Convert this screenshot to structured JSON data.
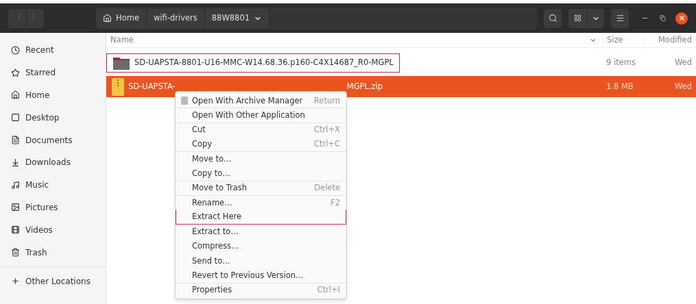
{
  "nav": {
    "back": "〈",
    "forward": "〉"
  },
  "breadcrumbs": [
    {
      "label": "Home",
      "kind": "home"
    },
    {
      "label": "wifi-drivers",
      "kind": "plain"
    },
    {
      "label": "88W8801",
      "kind": "current"
    }
  ],
  "sidebar": {
    "items": [
      {
        "label": "Recent"
      },
      {
        "label": "Starred"
      },
      {
        "label": "Home"
      },
      {
        "label": "Desktop"
      },
      {
        "label": "Documents"
      },
      {
        "label": "Downloads"
      },
      {
        "label": "Music"
      },
      {
        "label": "Pictures"
      },
      {
        "label": "Videos"
      },
      {
        "label": "Trash"
      }
    ],
    "other": "Other Locations"
  },
  "table": {
    "columns": [
      "Name",
      "Size",
      "Modified"
    ],
    "rows": [
      {
        "name": "SD-UAPSTA-8801-U16-MMC-W14.68.36.p160-C4X14687_R0-MGPL",
        "size": "9 items",
        "modified": "Wed",
        "kind": "folder",
        "selected": false,
        "highlighted": true
      },
      {
        "name_parts": [
          "SD-UAPSTA-",
          "MGPL.zip"
        ],
        "size": "1.8 MB",
        "modified": "Wed",
        "kind": "zip",
        "selected": true,
        "highlighted": false
      }
    ]
  },
  "context_menu": {
    "items": [
      {
        "label": "Open With Archive Manager",
        "shortcut": "Return",
        "divider_above": false,
        "highlighted": false,
        "icon": true
      },
      {
        "label": "Open With Other Application",
        "divider_above": true,
        "highlighted": false,
        "icon": false
      },
      {
        "label": "Cut",
        "shortcut": "Ctrl+X",
        "divider_above": true,
        "highlighted": false,
        "icon": false
      },
      {
        "label": "Copy",
        "shortcut": "Ctrl+C",
        "divider_above": false,
        "highlighted": false,
        "icon": false
      },
      {
        "label": "Move to…",
        "divider_above": true,
        "highlighted": false,
        "icon": false
      },
      {
        "label": "Copy to…",
        "divider_above": false,
        "highlighted": false,
        "icon": false
      },
      {
        "label": "Move to Trash",
        "shortcut": "Delete",
        "divider_above": true,
        "highlighted": false,
        "icon": false
      },
      {
        "label": "Rename…",
        "shortcut": "F2",
        "divider_above": true,
        "highlighted": false,
        "icon": false
      },
      {
        "label": "Extract Here",
        "divider_above": false,
        "highlighted": true,
        "icon": false
      },
      {
        "label": "Extract to…",
        "divider_above": false,
        "highlighted": false,
        "icon": false
      },
      {
        "label": "Compress…",
        "divider_above": false,
        "highlighted": false,
        "icon": false
      },
      {
        "label": "Send to…",
        "divider_above": false,
        "highlighted": false,
        "icon": false
      },
      {
        "label": "Revert to Previous Version…",
        "divider_above": false,
        "highlighted": false,
        "icon": false
      },
      {
        "label": "Properties",
        "shortcut": "Ctrl+I",
        "divider_above": true,
        "highlighted": false,
        "icon": false
      }
    ]
  }
}
